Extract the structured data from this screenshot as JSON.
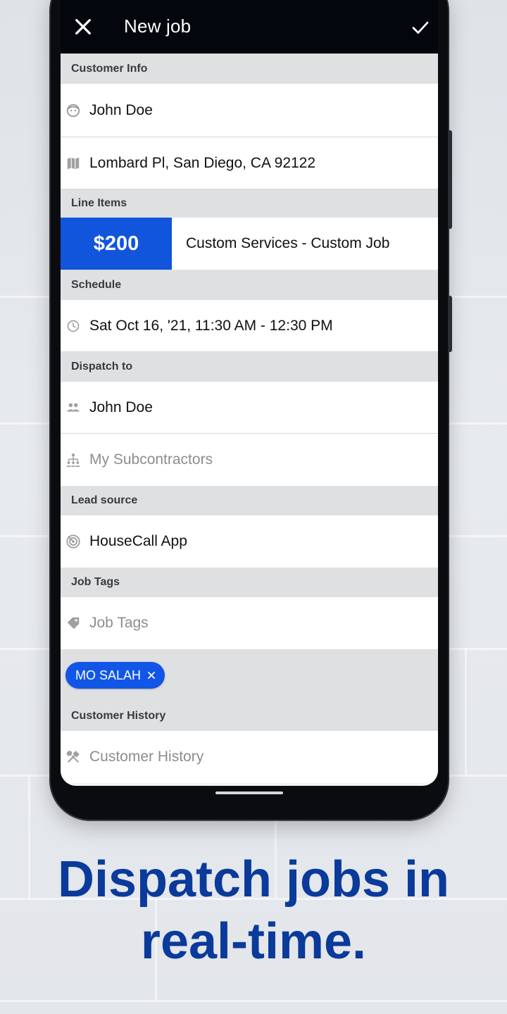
{
  "appbar": {
    "title": "New job"
  },
  "sections": {
    "customer_info": "Customer Info",
    "line_items": "Line Items",
    "schedule": "Schedule",
    "dispatch_to": "Dispatch to",
    "lead_source": "Lead source",
    "job_tags": "Job Tags",
    "customer_history": "Customer History"
  },
  "customer": {
    "name": "John Doe",
    "address": "Lombard Pl, San Diego, CA 92122"
  },
  "line_item": {
    "price": "$200",
    "description": "Custom Services - Custom Job"
  },
  "schedule": {
    "datetime": "Sat Oct 16, '21, 11:30 AM - 12:30 PM"
  },
  "dispatch": {
    "employee": "John Doe",
    "subcontractors_placeholder": "My Subcontractors"
  },
  "lead_source": {
    "value": "HouseCall App"
  },
  "job_tags": {
    "placeholder": "Job Tags",
    "chips": [
      "MO SALAH"
    ]
  },
  "customer_history": {
    "placeholder": "Customer History"
  },
  "headline": {
    "line1": "Dispatch jobs in",
    "line2": "real-time."
  },
  "colors": {
    "accent": "#1155dd",
    "headline": "#0a3a9a",
    "appbar": "#03060c"
  },
  "icons": {
    "close": "close-icon",
    "confirm": "check-icon",
    "customer": "face-icon",
    "address": "map-icon",
    "schedule": "clock-icon",
    "employee": "people-icon",
    "subcontractors": "org-chart-icon",
    "lead": "radar-icon",
    "tag": "tag-icon",
    "history": "tools-icon",
    "chip_remove": "close-icon"
  }
}
